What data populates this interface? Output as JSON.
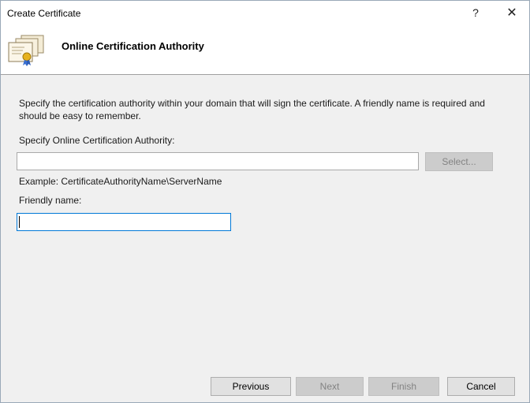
{
  "window": {
    "title": "Create Certificate",
    "help_glyph": "?",
    "close_glyph": "✕"
  },
  "header": {
    "title": "Online Certification Authority",
    "icon": "certificate-stack-icon"
  },
  "body": {
    "description": "Specify the certification authority within your domain that will sign the certificate. A friendly name is required and should be easy to remember.",
    "ca_label": "Specify Online Certification Authority:",
    "ca_value": "",
    "select_label": "Select...",
    "example_text": "Example: CertificateAuthorityName\\ServerName",
    "friendly_label": "Friendly name:",
    "friendly_value": ""
  },
  "footer": {
    "previous_label": "Previous",
    "next_label": "Next",
    "finish_label": "Finish",
    "cancel_label": "Cancel"
  },
  "colors": {
    "focus_border": "#0078d7",
    "disabled_button_bg": "#cccccc",
    "disabled_text": "#838383"
  }
}
